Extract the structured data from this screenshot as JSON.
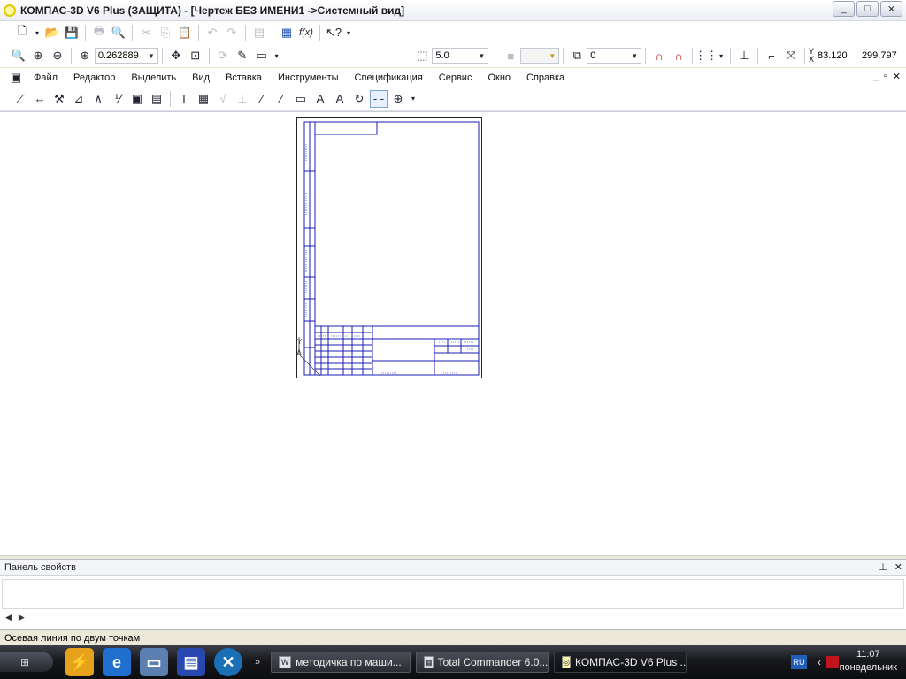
{
  "window": {
    "title": "КОМПАС-3D V6 Plus (ЗАЩИТА) - [Чертеж БЕЗ ИМЕНИ1 ->Системный вид]",
    "controls": [
      "_",
      "□",
      "✕"
    ]
  },
  "toolbar_view": {
    "zoom_value": "0.262889",
    "step_value": "5.0",
    "layer_value": "0",
    "coord_x": "83.120",
    "coord_y": "299.797",
    "coord_label_y": "Y",
    "coord_label_x": "X"
  },
  "menu": {
    "items": [
      "Файл",
      "Редактор",
      "Выделить",
      "Вид",
      "Вставка",
      "Инструменты",
      "Спецификация",
      "Сервис",
      "Окно",
      "Справка"
    ],
    "mdi_controls": [
      "_",
      "▫",
      "✕"
    ]
  },
  "drawing": {
    "sheet_title_block_text_1": "Лит.",
    "marker": "Y"
  },
  "properties_panel": {
    "title": "Панель свойств",
    "pin": "⊥",
    "close": "✕",
    "nav_left": "◀",
    "nav_right": "▶"
  },
  "status": {
    "text": "Осевая линия по двум точкам"
  },
  "taskbar": {
    "more": "»",
    "tasks": [
      {
        "label": "методичка по маши...",
        "icon": "W"
      },
      {
        "label": "Total Commander 6.0...",
        "icon": "▦"
      },
      {
        "label": "КОМПАС-3D V6 Plus ...",
        "icon": "◎"
      }
    ],
    "lang": "RU",
    "time": "11:07",
    "day": "понедельник"
  },
  "colors": {
    "drawing_lines": "#1b1fb4",
    "title_bar_bg": "#ffffff",
    "taskbar_bg": "#17181c"
  }
}
